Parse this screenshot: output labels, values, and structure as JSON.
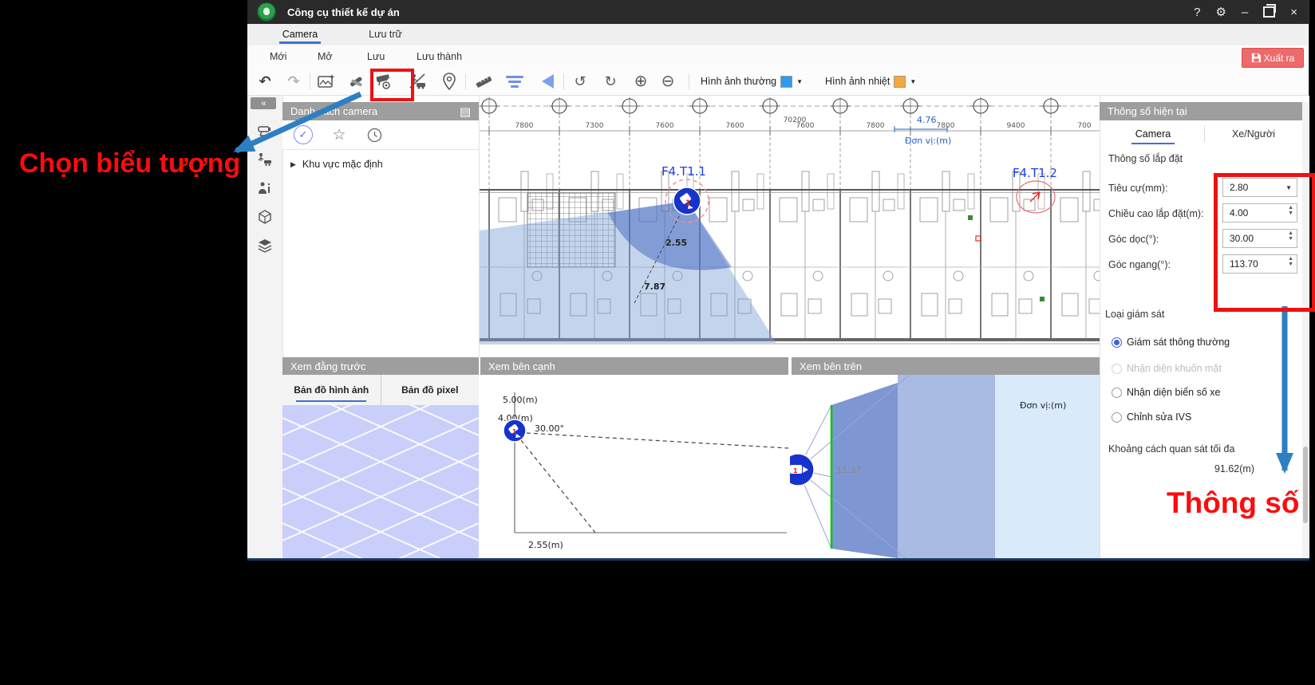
{
  "titlebar": {
    "title": "Công cụ thiết kế dự án"
  },
  "glyphs": {
    "help": "?",
    "gear": "⚙",
    "minimize": "–",
    "close": "×",
    "undo": "↶",
    "redo": "↷",
    "rotate_ccw": "↺",
    "rotate_cw": "↻",
    "zoom_in": "⊕",
    "zoom_out": "⊖",
    "caret_down": "▼",
    "spin_up": "▲",
    "spin_down": "▼",
    "collapse": "«",
    "list": "▤",
    "check": "✓",
    "star": "☆",
    "tree_arrow": "▶"
  },
  "tabs": {
    "camera": "Camera",
    "storage": "Lưu trữ"
  },
  "menu": {
    "new": "Mới",
    "open": "Mở",
    "save": "Lưu",
    "save_as": "Lưu thành"
  },
  "export_label": "Xuất ra",
  "toolbar": {
    "normal_label": "Hình ảnh thường",
    "thermal_label": "Hình ảnh nhiệt"
  },
  "camera_list": {
    "title": "Danh sách camera",
    "default_area": "Khu vực mặc định"
  },
  "plan": {
    "grid_dims": [
      "7800",
      "7300",
      "7600",
      "7600",
      "7600",
      "7800",
      "7800",
      "9400",
      "700"
    ],
    "overall_dim": "70200",
    "blue_dim": "4.76",
    "unit": "Đơn vị:(m)",
    "camera1_label": "F4.T1.1",
    "camera2_label": "F4.T1.2",
    "near_dist": "2.55",
    "far_dist": "7.87",
    "cam_num": "1"
  },
  "front_view": {
    "title": "Xem đằng trước",
    "tab_image": "Bản đồ hình ảnh",
    "tab_pixel": "Bản đồ pixel"
  },
  "side_view": {
    "title": "Xem bên cạnh",
    "height_max": "5.00(m)",
    "height_cam": "4.00(m)",
    "tilt": "30.00°",
    "ground_dist": "2.55(m)",
    "cam_num": "1"
  },
  "top_view": {
    "title": "Xem bên trên",
    "unit": "Đơn vị:(m)",
    "dist": "11.37",
    "cam_num": "1"
  },
  "params": {
    "title": "Thông số hiện tại",
    "tab_camera": "Camera",
    "tab_vehicle": "Xe/Người",
    "install_title": "Thông số lắp đặt",
    "focal_label": "Tiêu cự(mm):",
    "focal_value": "2.80",
    "height_label": "Chiều cao lắp đặt(m):",
    "height_value": "4.00",
    "vangle_label": "Góc dọc(°):",
    "vangle_value": "30.00",
    "hangle_label": "Góc ngang(°):",
    "hangle_value": "113.70",
    "monitor_title": "Loại giám sát",
    "opt_normal": "Giám sát thông thường",
    "opt_face": "Nhận diện khuôn mặt",
    "opt_plate": "Nhận diện biển số xe",
    "opt_ivs": "Chỉnh sửa IVS",
    "distance_label": "Khoảng cách quan sát tối đa",
    "distance_value": "91.62(m)"
  },
  "annotations": {
    "choose_icon": "Chọn biểu tượng",
    "params_note": "Thông số"
  },
  "colors": {
    "normal_swatch": "#2e9bf0",
    "thermal_swatch": "#f5a83a",
    "accent_blue": "#3f6fd6",
    "annotation_red": "#fb0d0d",
    "annotation_blue": "#2e7fc2"
  }
}
